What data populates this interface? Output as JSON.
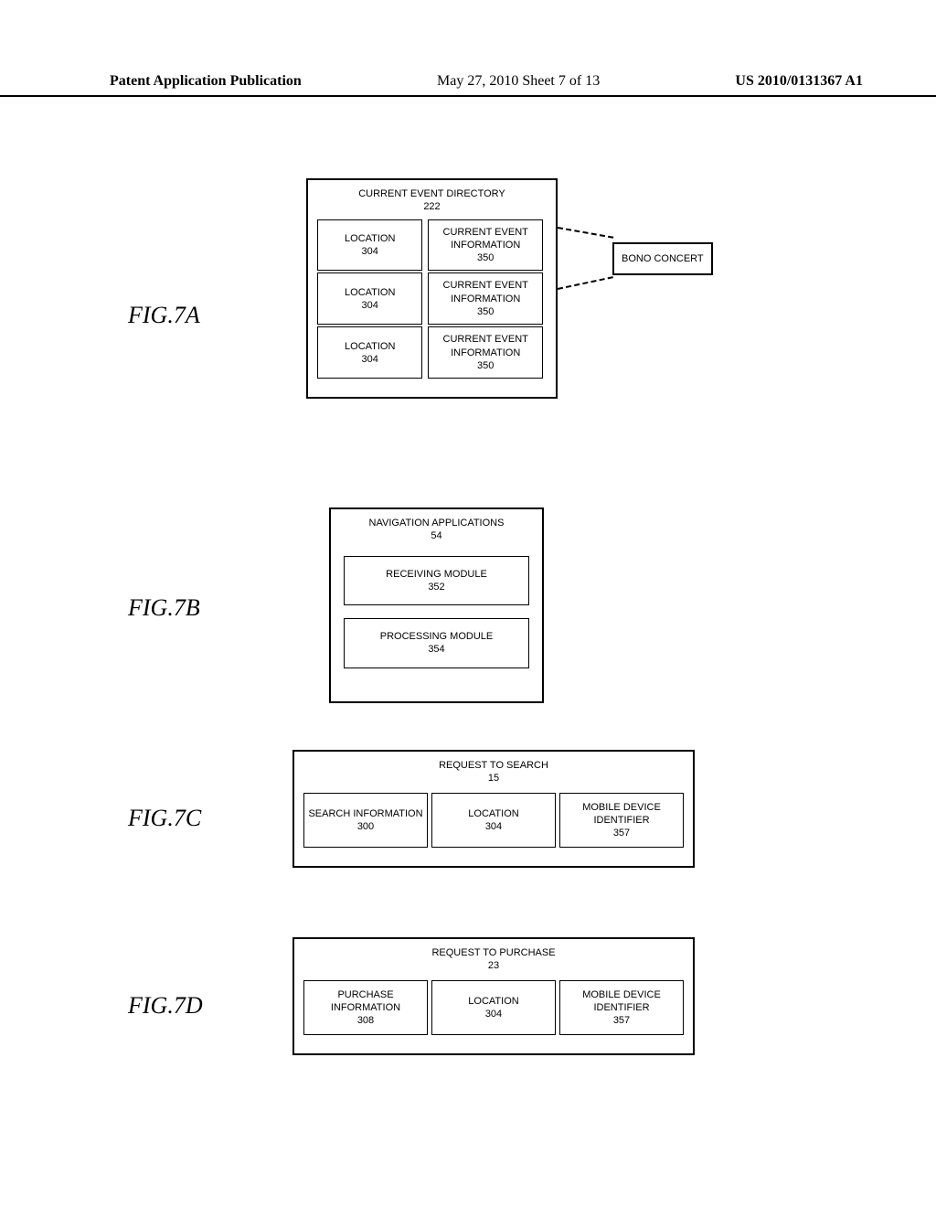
{
  "header": {
    "left": "Patent Application Publication",
    "mid": "May 27, 2010  Sheet 7 of 13",
    "right": "US 2010/0131367 A1"
  },
  "labels": {
    "figA": "FIG.7A",
    "figB": "FIG.7B",
    "figC": "FIG.7C",
    "figD": "FIG.7D"
  },
  "figA": {
    "title": "CURRENT EVENT DIRECTORY",
    "titleNum": "222",
    "rows": [
      {
        "loc": "LOCATION",
        "locNum": "304",
        "evt": "CURRENT EVENT INFORMATION",
        "evtNum": "350"
      },
      {
        "loc": "LOCATION",
        "locNum": "304",
        "evt": "CURRENT EVENT INFORMATION",
        "evtNum": "350"
      },
      {
        "loc": "LOCATION",
        "locNum": "304",
        "evt": "CURRENT EVENT INFORMATION",
        "evtNum": "350"
      }
    ],
    "callout": "BONO CONCERT"
  },
  "figB": {
    "title": "NAVIGATION APPLICATIONS",
    "titleNum": "54",
    "mod1": "RECEIVING MODULE",
    "mod1Num": "352",
    "mod2": "PROCESSING MODULE",
    "mod2Num": "354"
  },
  "figC": {
    "title": "REQUEST TO SEARCH",
    "titleNum": "15",
    "c1": "SEARCH INFORMATION",
    "c1Num": "300",
    "c2": "LOCATION",
    "c2Num": "304",
    "c3": "MOBILE DEVICE IDENTIFIER",
    "c3Num": "357"
  },
  "figD": {
    "title": "REQUEST TO PURCHASE",
    "titleNum": "23",
    "c1": "PURCHASE INFORMATION",
    "c1Num": "308",
    "c2": "LOCATION",
    "c2Num": "304",
    "c3": "MOBILE DEVICE IDENTIFIER",
    "c3Num": "357"
  }
}
